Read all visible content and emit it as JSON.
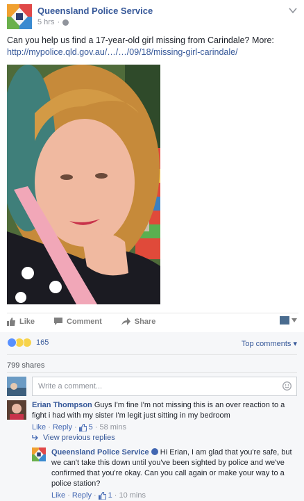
{
  "post": {
    "page_name": "Queensland Police Service",
    "time": "5 hrs",
    "text": "Can you help us find a 17-year-old girl missing from Carindale? More:",
    "link": "http://mypolice.qld.gov.au/…/…/09/18/missing-girl-carindale/"
  },
  "actions": {
    "like": "Like",
    "comment": "Comment",
    "share": "Share"
  },
  "reactions": {
    "count": "165",
    "types": [
      "like-icon",
      "sad-icon",
      "wow-icon"
    ],
    "top_comments": "Top comments"
  },
  "shares": "799 shares",
  "compose": {
    "placeholder": "Write a comment..."
  },
  "comments": [
    {
      "author": "Erian Thompson",
      "text": "Guys I'm fine I'm not missing this is an over reaction to a fight i had with my sister I'm legit just sitting in my bedroom",
      "like": "Like",
      "reply": "Reply",
      "likes": "5",
      "time": "58 mins"
    }
  ],
  "view_previous": "View previous replies",
  "reply": {
    "author": "Queensland Police Service",
    "text": "Hi Erian, I am glad that you're safe, but we can't take this down until you've been sighted by police and we've confirmed that you're okay. Can you call again or make your way to a police station?",
    "like": "Like",
    "reply": "Reply",
    "likes": "1",
    "time": "10 mins"
  },
  "colors": {
    "link": "#365899",
    "like_blue": "#5890ff",
    "muted": "#90949c",
    "comment_bg": "#f6f7f9"
  }
}
